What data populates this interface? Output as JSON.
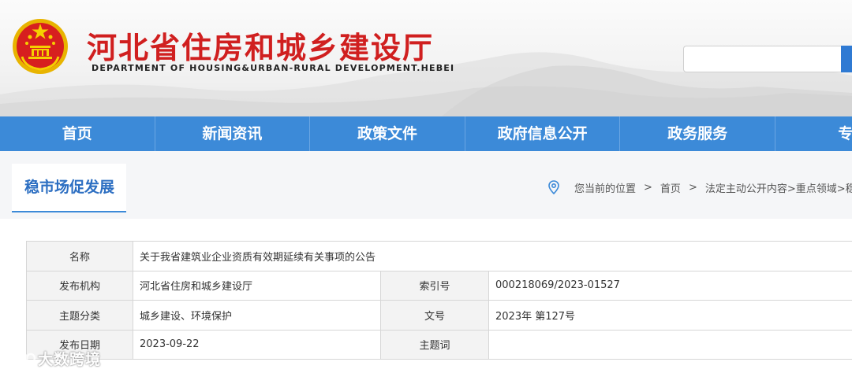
{
  "header": {
    "title": "河北省住房和城乡建设厅",
    "subtitle": "DEPARTMENT OF HOUSING&URBAN-RURAL DEVELOPMENT.HEBEI",
    "emblem_icon": "national-emblem-icon",
    "search": {
      "placeholder": "",
      "button_icon": "search-icon"
    }
  },
  "nav": {
    "items": [
      "首页",
      "新闻资讯",
      "政策文件",
      "政府信息公开",
      "政务服务",
      "专题"
    ]
  },
  "location": {
    "section_title": "稳市场促发展",
    "prefix": "您当前的位置",
    "separator": ">",
    "crumbs": [
      "首页",
      "法定主动公开内容>重点领域>稳"
    ],
    "pin_icon": "location-pin-icon"
  },
  "info": {
    "name_label": "名称",
    "name_value": "关于我省建筑业企业资质有效期延续有关事项的公告",
    "rows": [
      {
        "l1": "发布机构",
        "v1": "河北省住房和城乡建设厅",
        "l2": "索引号",
        "v2": "000218069/2023-01527"
      },
      {
        "l1": "主题分类",
        "v1": "城乡建设、环境保护",
        "l2": "文号",
        "v2": "2023年 第127号"
      },
      {
        "l1": "发布日期",
        "v1": "2023-09-22",
        "l2": "主题词",
        "v2": ""
      }
    ]
  },
  "watermark": {
    "text": "大数跨境",
    "icon": "brand-logo-icon"
  },
  "colors": {
    "title_red": "#d01f1f",
    "nav_blue": "#3c8ad8",
    "section_blue": "#2d6fc2",
    "label_bg": "#f3f3f3"
  }
}
